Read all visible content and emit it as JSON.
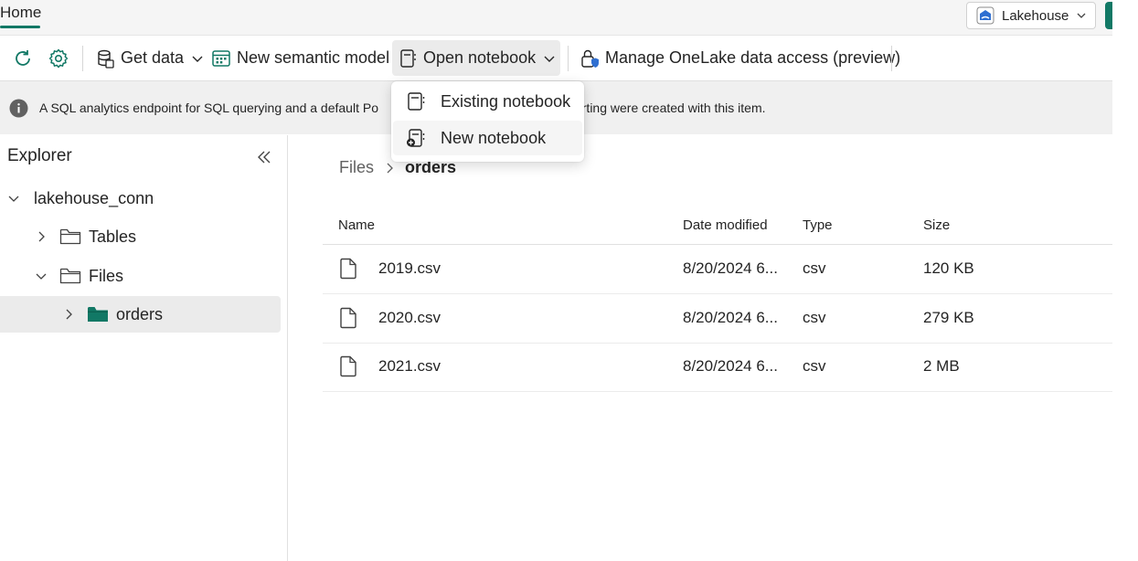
{
  "tabbar": {
    "home_tab": "Home",
    "workspace_label": "Lakehouse"
  },
  "ribbon": {
    "refresh_icon": "refresh-icon",
    "settings_icon": "gear-icon",
    "get_data": "Get data",
    "new_semantic_model": "New semantic model",
    "open_notebook": "Open notebook",
    "manage_onelake": "Manage OneLake data access (preview)"
  },
  "dropdown": {
    "items": [
      {
        "label": "Existing notebook",
        "icon": "notebook-icon"
      },
      {
        "label": "New notebook",
        "icon": "new-notebook-icon"
      }
    ]
  },
  "infobar": {
    "message": "A SQL analytics endpoint for SQL querying and a default Po",
    "message_tail": "orting were created with this item."
  },
  "explorer": {
    "title": "Explorer",
    "tree": {
      "root": "lakehouse_conn",
      "tables": "Tables",
      "files": "Files",
      "orders": "orders"
    }
  },
  "breadcrumb": {
    "parent": "Files",
    "current": "orders"
  },
  "table": {
    "columns": [
      "Name",
      "Date modified",
      "Type",
      "Size"
    ],
    "rows": [
      {
        "name": "2019.csv",
        "modified": "8/20/2024 6...",
        "type": "csv",
        "size": "120 KB"
      },
      {
        "name": "2020.csv",
        "modified": "8/20/2024 6...",
        "type": "csv",
        "size": "279 KB"
      },
      {
        "name": "2021.csv",
        "modified": "8/20/2024 6...",
        "type": "csv",
        "size": "2 MB"
      }
    ]
  },
  "colors": {
    "accent": "#117865",
    "folder_filled": "#117865"
  }
}
